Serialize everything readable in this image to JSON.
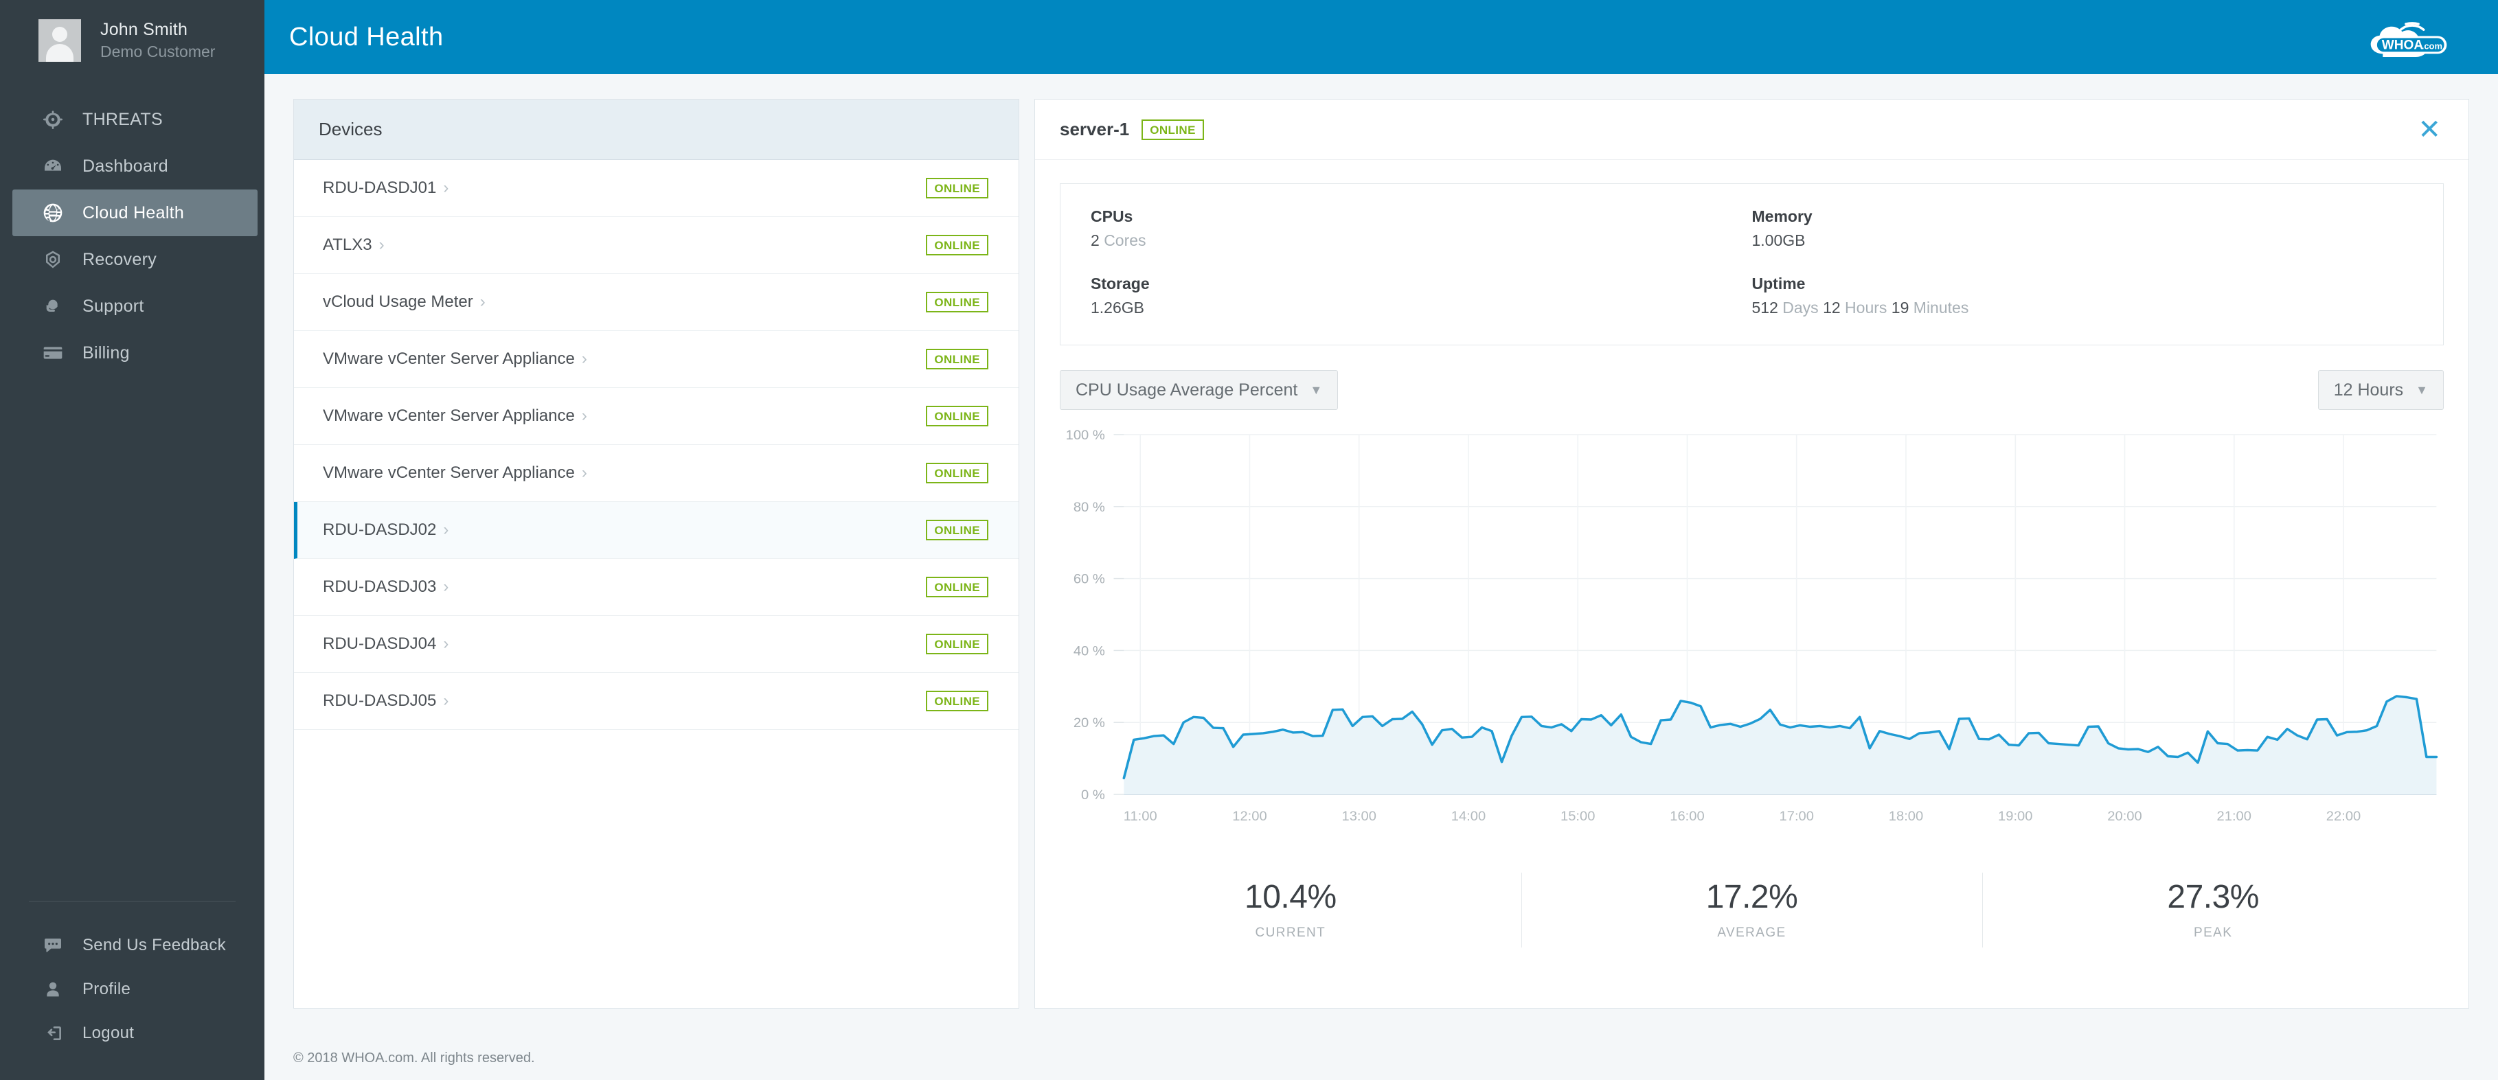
{
  "sidebar": {
    "user": {
      "name": "John Smith",
      "role": "Demo Customer"
    },
    "items": [
      {
        "label": "THREATS",
        "icon": "target-icon",
        "active": false
      },
      {
        "label": "Dashboard",
        "icon": "gauge-icon",
        "active": false
      },
      {
        "label": "Cloud Health",
        "icon": "globe-icon",
        "active": true
      },
      {
        "label": "Recovery",
        "icon": "recovery-icon",
        "active": false
      },
      {
        "label": "Support",
        "icon": "support-agent-icon",
        "active": false
      },
      {
        "label": "Billing",
        "icon": "credit-card-icon",
        "active": false
      }
    ],
    "bottom_items": [
      {
        "label": "Send Us Feedback",
        "icon": "chat-bubble-icon"
      },
      {
        "label": "Profile",
        "icon": "person-icon"
      },
      {
        "label": "Logout",
        "icon": "logout-icon"
      }
    ]
  },
  "topbar": {
    "title": "Cloud Health",
    "logo_text": "WHOA",
    "logo_suffix": ".com"
  },
  "devices_panel": {
    "header": "Devices",
    "rows": [
      {
        "name": "RDU-DASDJ01",
        "status": "ONLINE",
        "selected": false
      },
      {
        "name": "ATLX3",
        "status": "ONLINE",
        "selected": false
      },
      {
        "name": "vCloud Usage Meter",
        "status": "ONLINE",
        "selected": false
      },
      {
        "name": "VMware vCenter Server Appliance",
        "status": "ONLINE",
        "selected": false
      },
      {
        "name": "VMware vCenter Server Appliance",
        "status": "ONLINE",
        "selected": false
      },
      {
        "name": "VMware vCenter Server Appliance",
        "status": "ONLINE",
        "selected": false
      },
      {
        "name": "RDU-DASDJ02",
        "status": "ONLINE",
        "selected": true
      },
      {
        "name": "RDU-DASDJ03",
        "status": "ONLINE",
        "selected": false
      },
      {
        "name": "RDU-DASDJ04",
        "status": "ONLINE",
        "selected": false
      },
      {
        "name": "RDU-DASDJ05",
        "status": "ONLINE",
        "selected": false
      }
    ]
  },
  "detail_panel": {
    "title": "server-1",
    "status": "ONLINE",
    "close_label": "✕",
    "specs": [
      {
        "label": "CPUs",
        "value": "2",
        "unit": "Cores"
      },
      {
        "label": "Memory",
        "value": "1.00GB",
        "unit": ""
      },
      {
        "label": "Storage",
        "value": "1.26GB",
        "unit": ""
      },
      {
        "label": "Uptime",
        "value": "512",
        "unit": "Days",
        "value2": "12",
        "unit2": "Hours",
        "value3": "19",
        "unit3": "Minutes"
      }
    ],
    "metric_select": "CPU Usage Average Percent",
    "range_select": "12 Hours",
    "caret": "▼",
    "stats": [
      {
        "value": "10.4%",
        "label": "CURRENT"
      },
      {
        "value": "17.2%",
        "label": "AVERAGE"
      },
      {
        "value": "27.3%",
        "label": "PEAK"
      }
    ]
  },
  "footer": {
    "text": "© 2018 WHOA.com. All rights reserved."
  },
  "colors": {
    "brand_blue": "#0087c0",
    "sidebar_bg": "#333e45",
    "online_green": "#7cb518",
    "chart_line": "#1f9bd4",
    "chart_fill": "#eaf4f9"
  },
  "chart_data": {
    "type": "area",
    "title": "CPU Usage Average Percent",
    "xlabel": "",
    "ylabel": "%",
    "ylim": [
      0,
      100
    ],
    "yticks": [
      0,
      20,
      40,
      60,
      80,
      100
    ],
    "ytick_labels": [
      "0 %",
      "20 %",
      "40 %",
      "60 %",
      "80 %",
      "100 %"
    ],
    "xtick_labels": [
      "11:00",
      "12:00",
      "13:00",
      "14:00",
      "15:00",
      "16:00",
      "17:00",
      "18:00",
      "19:00",
      "20:00",
      "21:00",
      "22:00"
    ],
    "grid": true,
    "legend": "none",
    "series": [
      {
        "name": "CPU Usage Average Percent",
        "values": [
          4.5,
          15.2,
          15.6,
          16.2,
          16.4,
          14.0,
          20.0,
          21.5,
          21.3,
          18.5,
          18.4,
          13.2,
          16.6,
          16.8,
          17.0,
          17.4,
          18.0,
          17.2,
          17.3,
          16.2,
          16.3,
          23.5,
          23.6,
          19.0,
          21.5,
          21.7,
          19.0,
          20.9,
          21.0,
          23.0,
          19.5,
          13.8,
          17.8,
          18.2,
          15.8,
          16.0,
          18.6,
          17.6,
          9.0,
          16.3,
          21.5,
          21.6,
          19.0,
          18.6,
          19.5,
          17.6,
          20.9,
          20.8,
          22.0,
          19.2,
          22.2,
          16.0,
          14.5,
          14.0,
          20.6,
          20.8,
          26.0,
          25.5,
          24.5,
          18.6,
          19.3,
          19.6,
          18.8,
          19.7,
          21.0,
          23.5,
          19.4,
          18.6,
          19.2,
          18.8,
          19.0,
          18.6,
          19.0,
          18.4,
          21.5,
          12.8,
          17.6,
          16.8,
          16.2,
          15.4,
          17.0,
          17.2,
          17.6,
          12.6,
          21.0,
          21.1,
          15.4,
          15.3,
          16.6,
          13.8,
          13.6,
          17.0,
          17.1,
          14.2,
          14.0,
          13.8,
          13.6,
          18.8,
          18.9,
          14.2,
          12.8,
          12.5,
          12.6,
          11.8,
          13.2,
          10.6,
          10.4,
          11.6,
          8.8,
          17.5,
          14.2,
          14.0,
          12.2,
          12.3,
          12.2,
          16.0,
          15.2,
          18.2,
          16.4,
          15.3,
          20.8,
          20.9,
          16.4,
          17.3,
          17.4,
          17.8,
          19.0,
          25.8,
          27.3,
          27.0,
          26.5,
          10.4,
          10.4
        ]
      }
    ]
  }
}
